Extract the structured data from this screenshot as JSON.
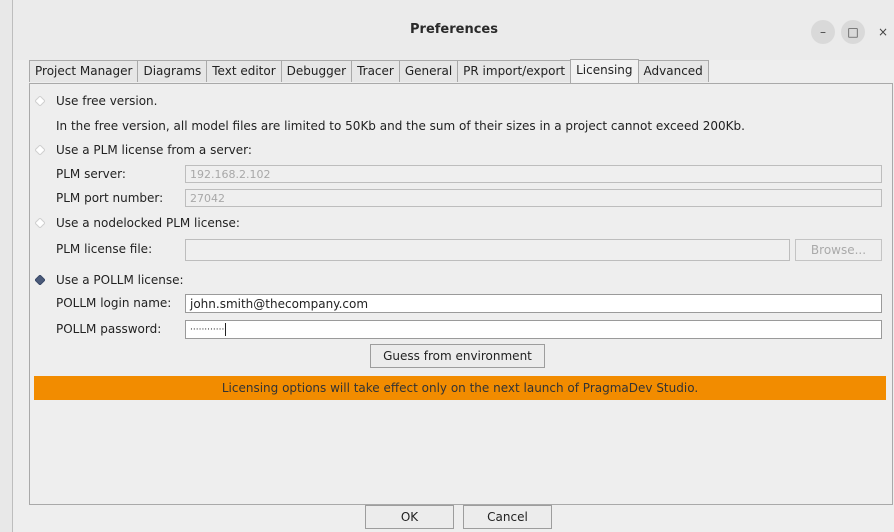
{
  "window": {
    "title": "Preferences",
    "controls": {
      "minimize": "–",
      "maximize": "□",
      "close": "×"
    }
  },
  "tabs": [
    {
      "label": "Project Manager"
    },
    {
      "label": "Diagrams"
    },
    {
      "label": "Text editor"
    },
    {
      "label": "Debugger"
    },
    {
      "label": "Tracer"
    },
    {
      "label": "General"
    },
    {
      "label": "PR import/export"
    },
    {
      "label": "Licensing",
      "active": true
    },
    {
      "label": "Advanced"
    }
  ],
  "licensing": {
    "free": {
      "label": "Use free version.",
      "description": "In the free version, all model files are limited to 50Kb and the sum of their sizes in a project cannot exceed 200Kb.",
      "selected": false
    },
    "server": {
      "label": "Use a PLM license from a server:",
      "selected": false,
      "server_label": "PLM server:",
      "server_value": "192.168.2.102",
      "port_label": "PLM port number:",
      "port_value": "27042"
    },
    "nodelocked": {
      "label": "Use a nodelocked PLM license:",
      "selected": false,
      "file_label": "PLM license file:",
      "file_value": "",
      "browse_label": "Browse..."
    },
    "pollm": {
      "label": "Use a POLLM license:",
      "selected": true,
      "login_label": "POLLM login name:",
      "login_value": "john.smith@thecompany.com",
      "password_label": "POLLM password:",
      "password_value": "············",
      "guess_label": "Guess from environment"
    },
    "notice": "Licensing options will take effect only on the next launch of PragmaDev Studio."
  },
  "footer": {
    "ok_label": "OK",
    "cancel_label": "Cancel"
  },
  "colors": {
    "notice_bg": "#f28c00",
    "selected_radio": "#4a5a7a"
  }
}
